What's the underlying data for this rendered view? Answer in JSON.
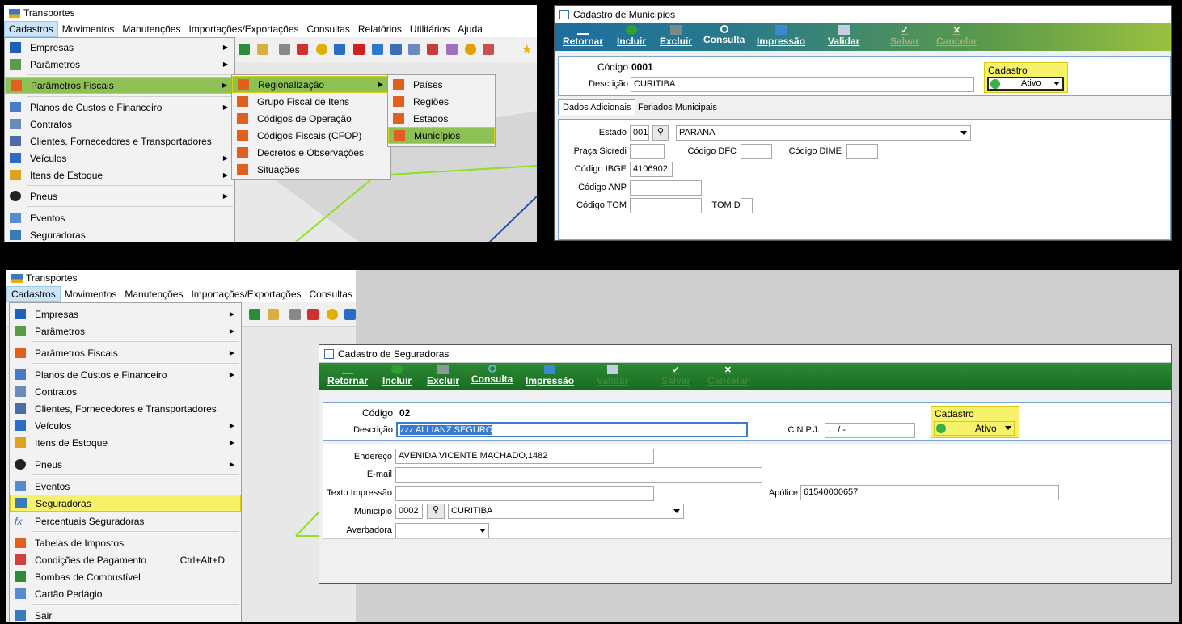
{
  "app": {
    "title": "Transportes"
  },
  "menubar_top": [
    "Cadastros",
    "Movimentos",
    "Manutenções",
    "Importações/Exportações",
    "Consultas",
    "Relatórios",
    "Utilitários",
    "Ajuda"
  ],
  "menubar_bottom": [
    "Cadastros",
    "Movimentos",
    "Manutenções",
    "Importações/Exportações",
    "Consultas"
  ],
  "cadastros_menu_top": [
    {
      "label": "Empresas",
      "icon": "building-icon",
      "submenu": true
    },
    {
      "label": "Parâmetros",
      "icon": "grid-icon",
      "submenu": true
    },
    {
      "label": "Parâmetros Fiscais",
      "icon": "tax-icon",
      "submenu": true
    },
    {
      "label": "Planos de Custos e Financeiro",
      "icon": "ledger-icon",
      "submenu": true
    },
    {
      "label": "Contratos",
      "icon": "contract-icon",
      "submenu": false
    },
    {
      "label": "Clientes, Fornecedores e Transportadores",
      "icon": "people-icon",
      "submenu": false
    },
    {
      "label": "Veículos",
      "icon": "bus-icon",
      "submenu": true
    },
    {
      "label": "Itens de Estoque",
      "icon": "boxes-icon",
      "submenu": true
    },
    {
      "label": "Pneus",
      "icon": "tire-icon",
      "submenu": true
    },
    {
      "label": "Eventos",
      "icon": "calendar-icon",
      "submenu": false
    },
    {
      "label": "Seguradoras",
      "icon": "insurer-icon",
      "submenu": false
    }
  ],
  "fiscal_submenu": [
    "Regionalização",
    "Grupo Fiscal de Itens",
    "Códigos de Operação",
    "Códigos Fiscais (CFOP)",
    "Decretos e Observações",
    "Situações"
  ],
  "regional_submenu": [
    "Países",
    "Regiões",
    "Estados",
    "Municípios"
  ],
  "cadastros_menu_bottom": [
    {
      "label": "Empresas",
      "submenu": true
    },
    {
      "label": "Parâmetros",
      "submenu": true
    },
    {
      "label": "Parâmetros Fiscais",
      "submenu": true
    },
    {
      "label": "Planos de Custos e Financeiro",
      "submenu": true
    },
    {
      "label": "Contratos",
      "submenu": false
    },
    {
      "label": "Clientes, Fornecedores e Transportadores",
      "submenu": false
    },
    {
      "label": "Veículos",
      "submenu": true
    },
    {
      "label": "Itens de Estoque",
      "submenu": true
    },
    {
      "label": "Pneus",
      "submenu": true
    },
    {
      "label": "Eventos",
      "submenu": false
    },
    {
      "label": "Seguradoras",
      "submenu": false
    },
    {
      "label": "Percentuais Seguradoras",
      "submenu": false
    },
    {
      "label": "Tabelas de Impostos",
      "submenu": false
    },
    {
      "label": "Condições de Pagamento",
      "shortcut": "Ctrl+Alt+D"
    },
    {
      "label": "Bombas de Combustível",
      "submenu": false
    },
    {
      "label": "Cartão Pedágio",
      "submenu": false
    },
    {
      "label": "Sair",
      "submenu": false
    }
  ],
  "municipios": {
    "title": "Cadastro de Municípios",
    "toolbar": [
      "Retornar",
      "Incluir",
      "Excluir",
      "Consulta",
      "Impressão",
      "Validar",
      "Salvar",
      "Cancelar"
    ],
    "codigo_label": "Código",
    "codigo": "0001",
    "descricao_label": "Descrição",
    "descricao": "CURITIBA",
    "cadastro_label": "Cadastro",
    "status": "Ativo",
    "tabs": [
      "Dados Adicionais",
      "Feriados Municipais"
    ],
    "estado_label": "Estado",
    "estado_code": "001",
    "estado_name": "PARANA",
    "praca_label": "Praça Sicredi",
    "dfc_label": "Código DFC",
    "dime_label": "Código DIME",
    "ibge_label": "Código IBGE",
    "ibge": "4106902",
    "anp_label": "Código ANP",
    "tom_label": "Código TOM",
    "tomdv_label": "TOM DV"
  },
  "seguradoras": {
    "title": "Cadastro de Seguradoras",
    "toolbar": [
      "Retornar",
      "Incluir",
      "Excluir",
      "Consulta",
      "Impressão",
      "Validar",
      "Salvar",
      "Cancelar"
    ],
    "codigo_label": "Código",
    "codigo": "02",
    "descricao_label": "Descrição",
    "descricao": "zzz ALLIANZ SEGURO",
    "cnpj_label": "C.N.P.J.",
    "cnpj": " .  .  /   -",
    "cadastro_label": "Cadastro",
    "status": "Ativo",
    "endereco_label": "Endereço",
    "endereco": "AVENIDA VICENTE MACHADO,1482",
    "email_label": "E-mail",
    "texto_label": "Texto Impressão",
    "apolice_label": "Apólice",
    "apolice": "61540000657",
    "municipio_label": "Município",
    "municipio_code": "0002",
    "municipio_name": "CURITIBA",
    "averbadora_label": "Averbadora"
  },
  "colors": {
    "highlight_green": "#8dc153",
    "highlight_yellow": "#f6f26a",
    "toolbar_green_dark": "#1e7a28",
    "toolbar_green_light": "#8ab83a"
  }
}
